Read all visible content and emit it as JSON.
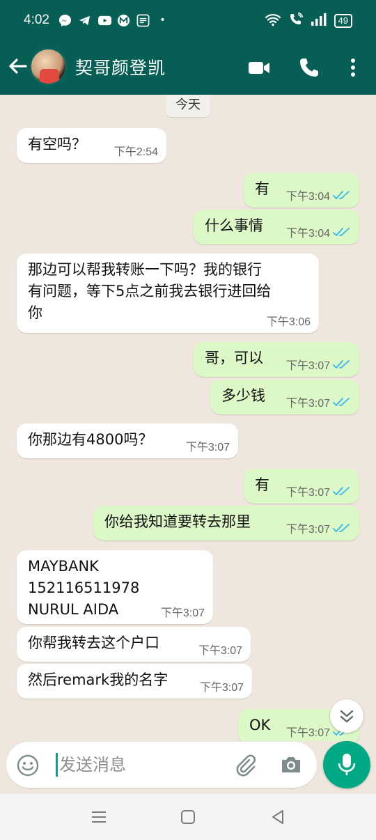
{
  "status_bar": {
    "time": "4:02",
    "battery": "49",
    "notification_icons": [
      "messenger-icon",
      "telegram-icon",
      "youtube-icon",
      "m-app-icon",
      "news-app-icon"
    ],
    "dot": "•"
  },
  "header": {
    "contact_name": "契哥颜登凯",
    "accent_color": "#075e54"
  },
  "chat": {
    "date_chip": "今天",
    "messages": [
      {
        "direction": "in",
        "text": "有空吗？",
        "time": "下午2:54"
      },
      {
        "direction": "out",
        "text": "有",
        "time": "下午3:04",
        "read": true
      },
      {
        "direction": "out",
        "text": "什么事情",
        "time": "下午3:04",
        "read": true
      },
      {
        "direction": "in",
        "text": "那边可以帮我转账一下吗？我的银行\n有问题，等下5点之前我去银行进回给\n你",
        "time": "下午3:06"
      },
      {
        "direction": "out",
        "text": "哥，可以",
        "time": "下午3:07",
        "read": true
      },
      {
        "direction": "out",
        "text": "多少钱",
        "time": "下午3:07",
        "read": true
      },
      {
        "direction": "in",
        "text": "你那边有4800吗？",
        "time": "下午3:07"
      },
      {
        "direction": "out",
        "text": "有",
        "time": "下午3:07",
        "read": true
      },
      {
        "direction": "out",
        "text": "你给我知道要转去那里",
        "time": "下午3:07",
        "read": true
      },
      {
        "direction": "in",
        "text": "MAYBANK\n152116511978\nNURUL AIDA",
        "time": "下午3:07"
      },
      {
        "direction": "in",
        "text": "你帮我转去这个户口",
        "time": "下午3:07"
      },
      {
        "direction": "in",
        "text": "然后remark我的名字",
        "time": "下午3:07"
      },
      {
        "direction": "out",
        "text": "OK",
        "time": "下午3:07",
        "read": true
      }
    ]
  },
  "composer": {
    "placeholder": "发送消息"
  },
  "colors": {
    "incoming_bubble": "#ffffff",
    "outgoing_bubble": "#dcf8c6",
    "read_ticks": "#34b7f1",
    "mic_button": "#00a884"
  }
}
